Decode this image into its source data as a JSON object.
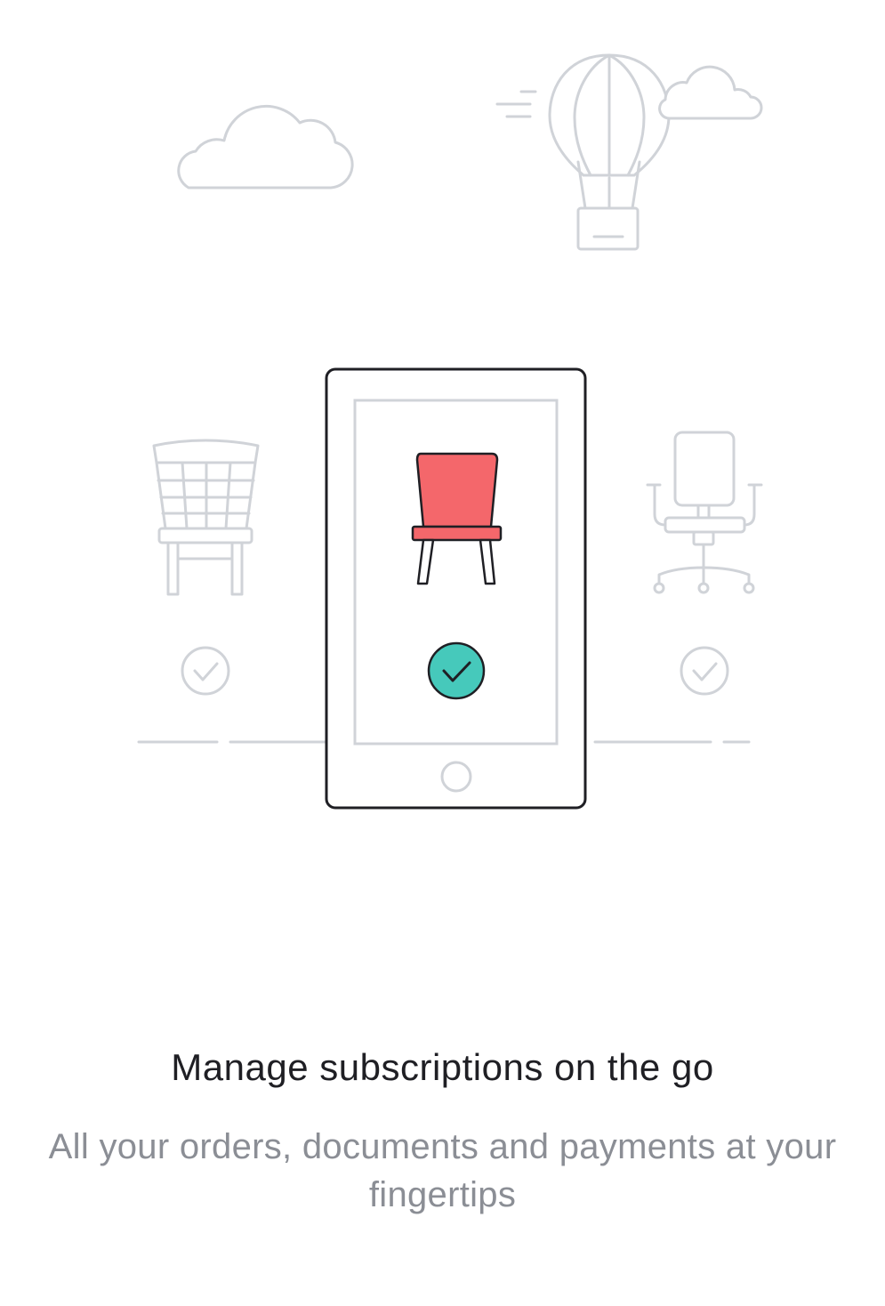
{
  "onboarding": {
    "title": "Manage subscriptions on the go",
    "subtitle": "All your orders, documents and payments at your fingertips"
  },
  "illustration": {
    "icons": [
      "cloud-icon",
      "hot-air-balloon-icon",
      "cloud-icon",
      "wooden-chair-icon",
      "smartphone-icon",
      "red-chair-icon",
      "checkmark-circle-icon",
      "office-chair-icon"
    ],
    "colors": {
      "outline_light": "#d0d3d8",
      "outline_dark": "#1f1f24",
      "chair_accent": "#f4676b",
      "check_accent": "#46c9bb"
    }
  }
}
